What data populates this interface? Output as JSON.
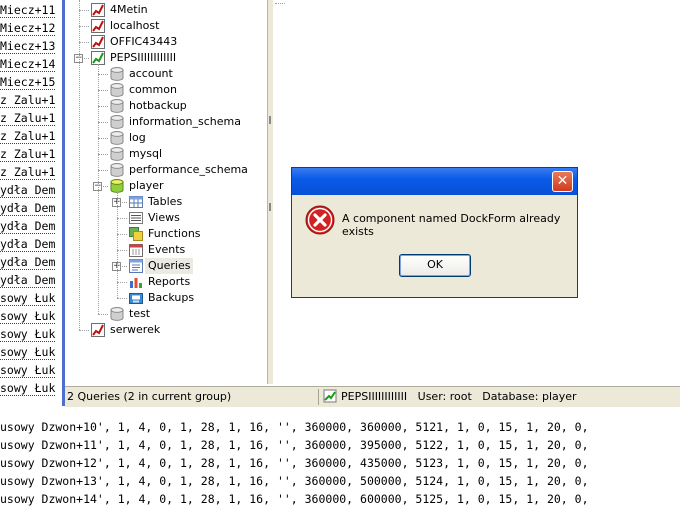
{
  "code_left": [
    "Miecz+11",
    "Miecz+12",
    "Miecz+13",
    "Miecz+14",
    "Miecz+15",
    "z Zalu+1",
    "z Zalu+1",
    "z Zalu+1",
    "z Zalu+1",
    "z Zalu+1",
    "ydła Dem",
    "ydła Dem",
    "ydła Dem",
    "ydła Dem",
    "ydła Dem",
    "ydła Dem",
    "sowy Łuk",
    "sowy Łuk",
    "sowy Łuk",
    "sowy Łuk",
    "sowy Łuk",
    "sowy Łuk"
  ],
  "code_bottom": [
    "usowy Dzwon+10', 1, 4, 0, 1, 28, 1, 16, '', 360000, 360000, 5121, 1, 0, 15, 1, 20, 0,",
    "usowy Dzwon+11', 1, 4, 0, 1, 28, 1, 16, '', 360000, 395000, 5122, 1, 0, 15, 1, 20, 0,",
    "usowy Dzwon+12', 1, 4, 0, 1, 28, 1, 16, '', 360000, 435000, 5123, 1, 0, 15, 1, 20, 0,",
    "usowy Dzwon+13', 1, 4, 0, 1, 28, 1, 16, '', 360000, 500000, 5124, 1, 0, 15, 1, 20, 0,",
    "usowy Dzwon+14', 1, 4, 0, 1, 28, 1, 16, '', 360000, 600000, 5125, 1, 0, 15, 1, 20, 0,"
  ],
  "tree": {
    "connections": [
      "4Metin",
      "localhost",
      "OFFIC43443",
      "PEPSIIIIIIIIIIII"
    ],
    "databases": [
      "account",
      "common",
      "hotbackup",
      "information_schema",
      "log",
      "mysql",
      "performance_schema",
      "player"
    ],
    "player_children": [
      "Tables",
      "Views",
      "Functions",
      "Events",
      "Queries",
      "Reports",
      "Backups"
    ],
    "after": [
      "test"
    ],
    "last_connection": "serwerek"
  },
  "status": {
    "left": "2 Queries (2 in current group)",
    "connection": "PEPSIIIIIIIIIIII",
    "user": "User: root",
    "database": "Database: player"
  },
  "dialog": {
    "message": "A component named DockForm already exists",
    "ok_label": "OK",
    "close_glyph": "✕"
  },
  "colors": {
    "accent": "#4e6fd2",
    "error": "#d32020",
    "title_blue": "#0a5ae8"
  }
}
